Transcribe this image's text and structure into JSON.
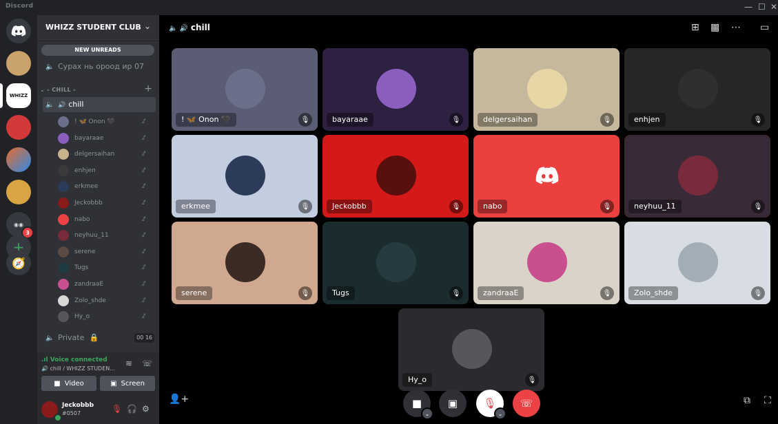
{
  "app": {
    "brand": "Discord",
    "window_controls": [
      "—",
      "☐",
      "✕"
    ]
  },
  "rail": {
    "servers": [
      {
        "label": "",
        "icon": "discord-home-icon",
        "color": "#5865f2"
      },
      {
        "label": "",
        "icon": "server-avatar",
        "color": "#c9a36b"
      },
      {
        "label": "WHIZZ",
        "icon": "server-whizz",
        "color": "#ffffff"
      },
      {
        "label": "",
        "icon": "server-red-mask",
        "color": "#d23a3a"
      },
      {
        "label": "",
        "icon": "server-colorful",
        "color": "#e86b2c"
      },
      {
        "label": "",
        "icon": "server-doge",
        "color": "#d9a441"
      },
      {
        "label": "",
        "icon": "server-folder",
        "color": "#4f545c"
      }
    ],
    "folder_badge": "3",
    "add_server": "+",
    "explore": "🧭"
  },
  "sidebar": {
    "guild_name": "WHIZZ STUDENT CLUB",
    "new_unreads": "NEW UNREADS",
    "channels": [
      {
        "label": "Сурах нь ороод ир 07"
      }
    ],
    "category": "CHILL",
    "active_channel": "chill",
    "members": [
      {
        "name": "! 🦋 Onon 🖤",
        "color": "#6b6f8a"
      },
      {
        "name": "bayaraae",
        "color": "#8a5fbf"
      },
      {
        "name": "delgersaihan",
        "color": "#c7b28d"
      },
      {
        "name": "enhjen",
        "color": "#3a3a3a"
      },
      {
        "name": "erkmee",
        "color": "#2c3b5a"
      },
      {
        "name": "Jeckobbb",
        "color": "#8b1a1a"
      },
      {
        "name": "nabo",
        "color": "#ed4245"
      },
      {
        "name": "neyhuu_11",
        "color": "#7a2b3b"
      },
      {
        "name": "serene",
        "color": "#5a4a44"
      },
      {
        "name": "Tugs",
        "color": "#1f3a40"
      },
      {
        "name": "zandraaE",
        "color": "#c94f8f"
      },
      {
        "name": "Zolo_shde",
        "color": "#d8d8d8"
      },
      {
        "name": "Hy_o",
        "color": "#55575c"
      }
    ],
    "private_channel": "Private",
    "private_count_a": "00",
    "private_count_b": "16"
  },
  "voice": {
    "status": "Voice connected",
    "location": "chill / WHIZZ STUDEN...",
    "video_label": "Video",
    "screen_label": "Screen"
  },
  "user": {
    "name": "Jeckobbb",
    "tag": "#0507"
  },
  "main": {
    "channel_title": "chill",
    "tiles": [
      {
        "name": "! 🦋 Onon 🖤",
        "bg": "#5a5d74",
        "av": "#6b6f8a"
      },
      {
        "name": "bayaraae",
        "bg": "#2d2040",
        "av": "#8a5fbf"
      },
      {
        "name": "delgersaihan",
        "bg": "#c6b89c",
        "av": "#e8d7a6"
      },
      {
        "name": "enhjen",
        "bg": "#262626",
        "av": "#2f2f2f"
      },
      {
        "name": "erkmee",
        "bg": "#c3cde0",
        "av": "#2c3b5a"
      },
      {
        "name": "Jeckobbb",
        "bg": "#d41919",
        "av": "#5a0f0f"
      },
      {
        "name": "nabo",
        "bg": "#ec4040",
        "av": "#ec4040"
      },
      {
        "name": "neyhuu_11",
        "bg": "#3a2a38",
        "av": "#7a2b3b"
      },
      {
        "name": "serene",
        "bg": "#cfa88f",
        "av": "#3a2b25"
      },
      {
        "name": "Tugs",
        "bg": "#1b2c2e",
        "av": "#263b40"
      },
      {
        "name": "zandraaE",
        "bg": "#d9d3c8",
        "av": "#c94f8f"
      },
      {
        "name": "Zolo_shde",
        "bg": "#d7dde2",
        "av": "#a3adb6"
      },
      {
        "name": "Hy_o",
        "bg": "#2a2b2e",
        "av": "#55575c"
      }
    ]
  }
}
